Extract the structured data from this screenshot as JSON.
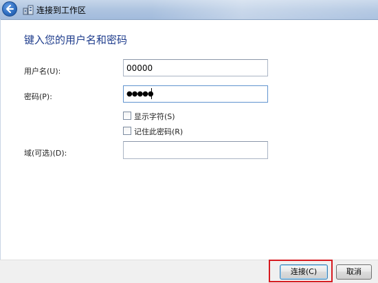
{
  "window": {
    "title": "连接到工作区",
    "back_icon": "back-arrow-icon",
    "app_icon": "network-workplace-icon"
  },
  "form": {
    "heading": "键入您的用户名和密码",
    "username_label": "用户名(U):",
    "username_value": "00000",
    "password_label": "密码(P):",
    "password_mask": "●●●●●",
    "show_chars_label": "显示字符(S)",
    "show_chars_checked": false,
    "remember_label": "记住此密码(R)",
    "remember_checked": false,
    "domain_label": "域(可选)(D):",
    "domain_value": ""
  },
  "footer": {
    "connect_label": "连接(C)",
    "cancel_label": "取消"
  },
  "colors": {
    "heading": "#1e3c8c",
    "highlight_box": "#d6191f"
  }
}
